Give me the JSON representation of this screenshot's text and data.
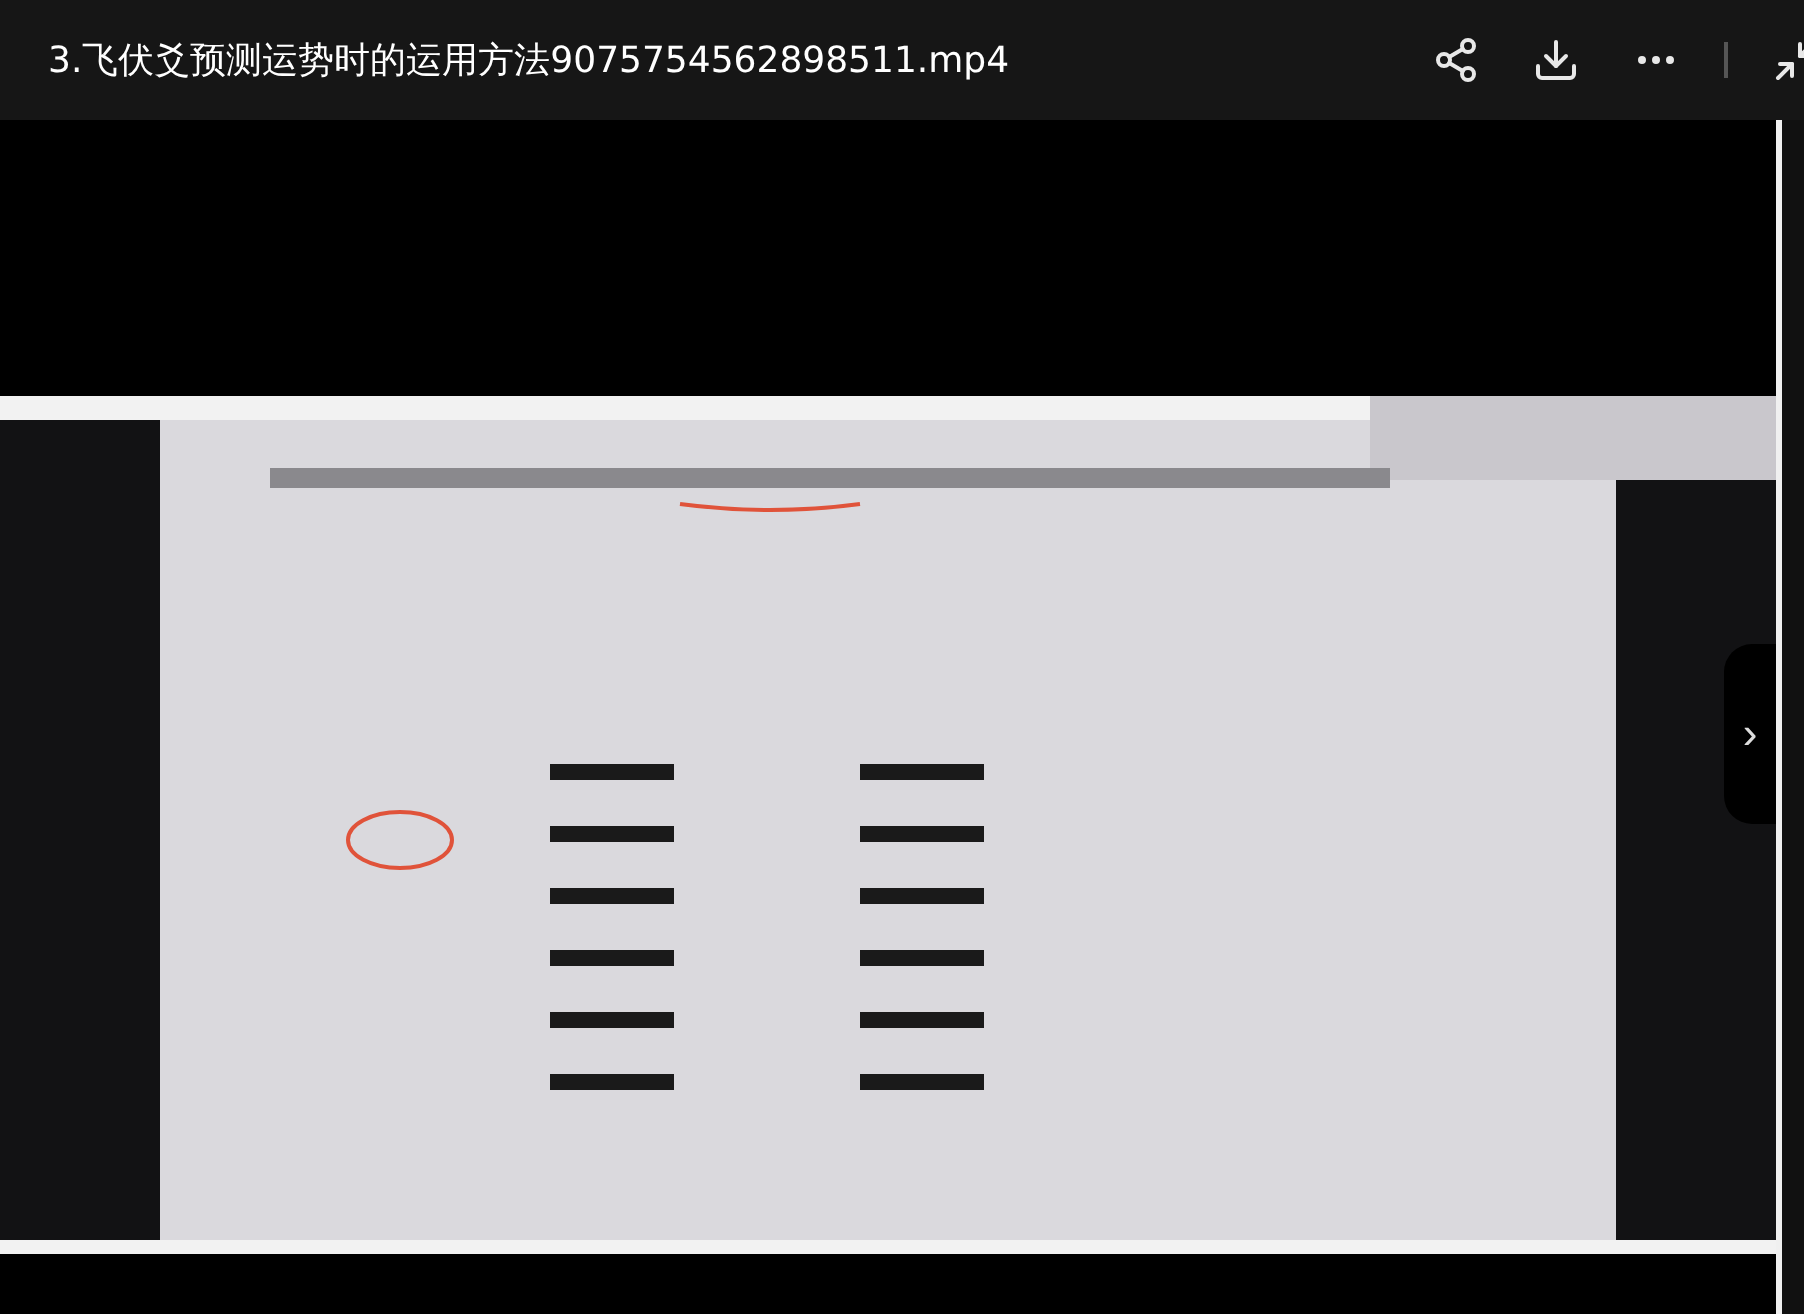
{
  "title": "3.飞伏爻预测运势时的运用方法9075754562898511.mp4",
  "next_button": {
    "label": "›"
  }
}
